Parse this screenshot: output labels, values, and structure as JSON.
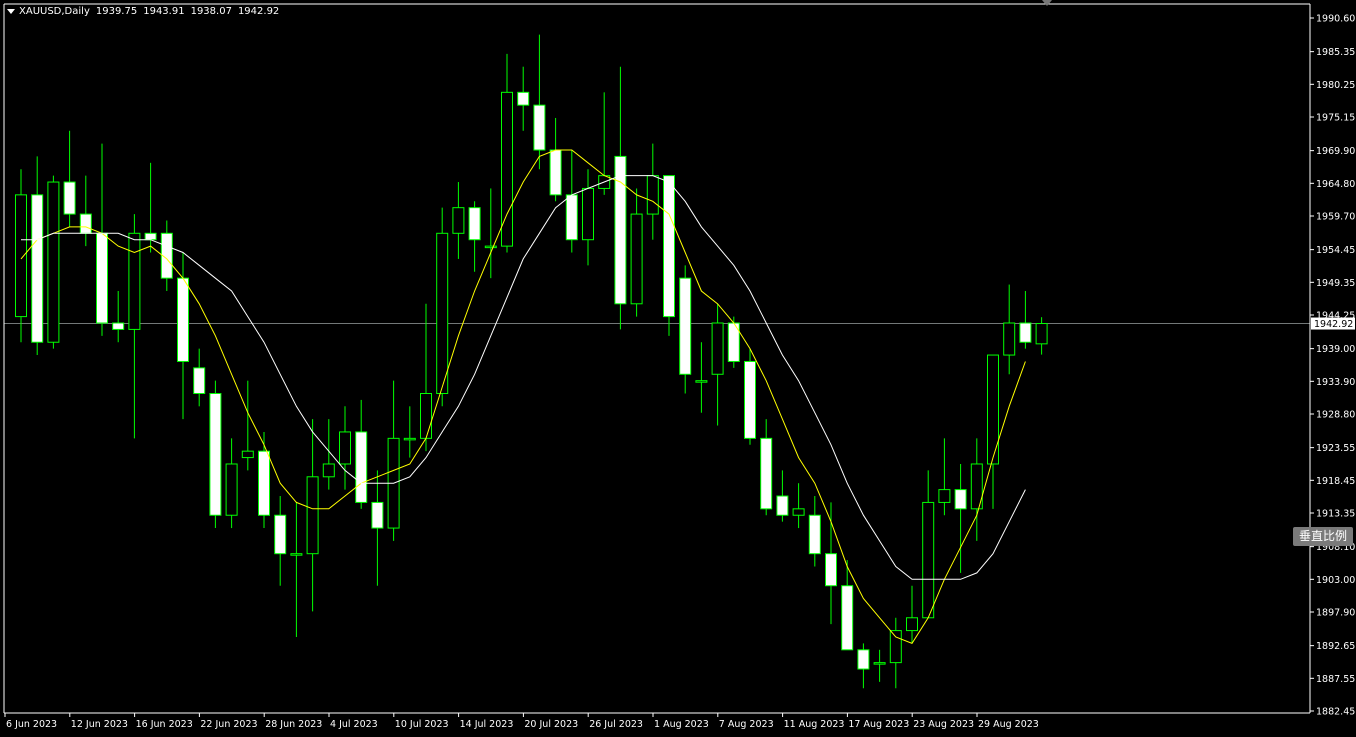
{
  "header": {
    "symbol": "XAUUSD,Daily",
    "open": "1939.75",
    "high": "1943.91",
    "low": "1938.07",
    "close": "1942.92"
  },
  "scale_button_label": "垂直比例",
  "colors": {
    "background": "#000000",
    "up_candle": "#000000",
    "down_candle": "#ffffff",
    "wick": "#00ff00",
    "ma_fast": "#ffff00",
    "ma_slow": "#ffffff",
    "axis": "#ffffff"
  },
  "chart_data": {
    "type": "candlestick",
    "title": "",
    "xlabel": "",
    "ylabel": "",
    "current_price": 1942.92,
    "ylim": [
      1882.45,
      1992.0
    ],
    "y_ticks": [
      "1990.60",
      "1985.35",
      "1980.25",
      "1975.15",
      "1969.90",
      "1964.80",
      "1959.70",
      "1954.45",
      "1949.35",
      "1944.25",
      "1939.00",
      "1933.90",
      "1928.80",
      "1923.55",
      "1918.45",
      "1913.35",
      "1908.10",
      "1903.00",
      "1897.90",
      "1892.65",
      "1887.55",
      "1882.45"
    ],
    "x_ticks": [
      {
        "label": "6 Jun 2023",
        "index": 0
      },
      {
        "label": "12 Jun 2023",
        "index": 4
      },
      {
        "label": "16 Jun 2023",
        "index": 8
      },
      {
        "label": "22 Jun 2023",
        "index": 12
      },
      {
        "label": "28 Jun 2023",
        "index": 16
      },
      {
        "label": "4 Jul 2023",
        "index": 20
      },
      {
        "label": "10 Jul 2023",
        "index": 24
      },
      {
        "label": "14 Jul 2023",
        "index": 28
      },
      {
        "label": "20 Jul 2023",
        "index": 32
      },
      {
        "label": "26 Jul 2023",
        "index": 36
      },
      {
        "label": "1 Aug 2023",
        "index": 40
      },
      {
        "label": "7 Aug 2023",
        "index": 44
      },
      {
        "label": "11 Aug 2023",
        "index": 48
      },
      {
        "label": "17 Aug 2023",
        "index": 52
      },
      {
        "label": "23 Aug 2023",
        "index": 56
      },
      {
        "label": "29 Aug 2023",
        "index": 60
      }
    ],
    "candles": [
      {
        "o": 1944,
        "h": 1967,
        "l": 1940,
        "c": 1963
      },
      {
        "o": 1963,
        "h": 1969,
        "l": 1938,
        "c": 1940
      },
      {
        "o": 1940,
        "h": 1966,
        "l": 1939,
        "c": 1965
      },
      {
        "o": 1965,
        "h": 1973,
        "l": 1958,
        "c": 1960
      },
      {
        "o": 1960,
        "h": 1966,
        "l": 1955,
        "c": 1957
      },
      {
        "o": 1957,
        "h": 1971,
        "l": 1941,
        "c": 1943
      },
      {
        "o": 1943,
        "h": 1948,
        "l": 1940,
        "c": 1942
      },
      {
        "o": 1942,
        "h": 1960,
        "l": 1925,
        "c": 1957
      },
      {
        "o": 1957,
        "h": 1968,
        "l": 1954,
        "c": 1956
      },
      {
        "o": 1957,
        "h": 1959,
        "l": 1948,
        "c": 1950
      },
      {
        "o": 1950,
        "h": 1954,
        "l": 1928,
        "c": 1937
      },
      {
        "o": 1936,
        "h": 1939,
        "l": 1930,
        "c": 1932
      },
      {
        "o": 1932,
        "h": 1934,
        "l": 1911,
        "c": 1913
      },
      {
        "o": 1913,
        "h": 1925,
        "l": 1911,
        "c": 1921
      },
      {
        "o": 1922,
        "h": 1934,
        "l": 1920,
        "c": 1923
      },
      {
        "o": 1923,
        "h": 1926,
        "l": 1911,
        "c": 1913
      },
      {
        "o": 1913,
        "h": 1916,
        "l": 1902,
        "c": 1907
      },
      {
        "o": 1907,
        "h": 1915,
        "l": 1894,
        "c": 1907
      },
      {
        "o": 1907,
        "h": 1928,
        "l": 1898,
        "c": 1919
      },
      {
        "o": 1919,
        "h": 1928,
        "l": 1917,
        "c": 1921
      },
      {
        "o": 1921,
        "h": 1930,
        "l": 1917,
        "c": 1926
      },
      {
        "o": 1926,
        "h": 1931,
        "l": 1914,
        "c": 1915
      },
      {
        "o": 1915,
        "h": 1920,
        "l": 1902,
        "c": 1911
      },
      {
        "o": 1911,
        "h": 1934,
        "l": 1909,
        "c": 1925
      },
      {
        "o": 1925,
        "h": 1930,
        "l": 1922,
        "c": 1925
      },
      {
        "o": 1925,
        "h": 1946,
        "l": 1923,
        "c": 1932
      },
      {
        "o": 1932,
        "h": 1961,
        "l": 1930,
        "c": 1957
      },
      {
        "o": 1957,
        "h": 1965,
        "l": 1953,
        "c": 1961
      },
      {
        "o": 1961,
        "h": 1962,
        "l": 1951,
        "c": 1956
      },
      {
        "o": 1955,
        "h": 1964,
        "l": 1950,
        "c": 1955
      },
      {
        "o": 1955,
        "h": 1985,
        "l": 1954,
        "c": 1979
      },
      {
        "o": 1979,
        "h": 1983,
        "l": 1973,
        "c": 1977
      },
      {
        "o": 1977,
        "h": 1988,
        "l": 1967,
        "c": 1970
      },
      {
        "o": 1970,
        "h": 1975,
        "l": 1962,
        "c": 1963
      },
      {
        "o": 1963,
        "h": 1970,
        "l": 1954,
        "c": 1956
      },
      {
        "o": 1956,
        "h": 1967,
        "l": 1952,
        "c": 1964
      },
      {
        "o": 1964,
        "h": 1979,
        "l": 1963,
        "c": 1966
      },
      {
        "o": 1969,
        "h": 1983,
        "l": 1942,
        "c": 1946
      },
      {
        "o": 1946,
        "h": 1964,
        "l": 1944,
        "c": 1960
      },
      {
        "o": 1960,
        "h": 1971,
        "l": 1956,
        "c": 1966
      },
      {
        "o": 1966,
        "h": 1966,
        "l": 1941,
        "c": 1944
      },
      {
        "o": 1950,
        "h": 1952,
        "l": 1932,
        "c": 1935
      },
      {
        "o": 1934,
        "h": 1940,
        "l": 1929,
        "c": 1934
      },
      {
        "o": 1935,
        "h": 1946,
        "l": 1927,
        "c": 1943
      },
      {
        "o": 1943,
        "h": 1944,
        "l": 1936,
        "c": 1937
      },
      {
        "o": 1937,
        "h": 1939,
        "l": 1924,
        "c": 1925
      },
      {
        "o": 1925,
        "h": 1928,
        "l": 1913,
        "c": 1914
      },
      {
        "o": 1916,
        "h": 1920,
        "l": 1912,
        "c": 1913
      },
      {
        "o": 1913,
        "h": 1918,
        "l": 1911,
        "c": 1914
      },
      {
        "o": 1913,
        "h": 1916,
        "l": 1905,
        "c": 1907
      },
      {
        "o": 1907,
        "h": 1915,
        "l": 1896,
        "c": 1902
      },
      {
        "o": 1902,
        "h": 1906,
        "l": 1892,
        "c": 1892
      },
      {
        "o": 1892,
        "h": 1893,
        "l": 1886,
        "c": 1889
      },
      {
        "o": 1890,
        "h": 1892,
        "l": 1887,
        "c": 1890
      },
      {
        "o": 1890,
        "h": 1897,
        "l": 1886,
        "c": 1895
      },
      {
        "o": 1895,
        "h": 1902,
        "l": 1893,
        "c": 1897
      },
      {
        "o": 1897,
        "h": 1920,
        "l": 1897,
        "c": 1915
      },
      {
        "o": 1915,
        "h": 1925,
        "l": 1913,
        "c": 1917
      },
      {
        "o": 1917,
        "h": 1921,
        "l": 1904,
        "c": 1914
      },
      {
        "o": 1914,
        "h": 1925,
        "l": 1909,
        "c": 1921
      },
      {
        "o": 1921,
        "h": 1938,
        "l": 1914,
        "c": 1938
      },
      {
        "o": 1938,
        "h": 1949,
        "l": 1935,
        "c": 1943
      },
      {
        "o": 1943,
        "h": 1948,
        "l": 1939,
        "c": 1940
      },
      {
        "o": 1939.75,
        "h": 1943.91,
        "l": 1938.07,
        "c": 1942.92
      }
    ],
    "series": [
      {
        "type": "line",
        "values": [
          1953,
          1956,
          1957,
          1958,
          1958,
          1957,
          1955,
          1954,
          1955,
          1953,
          1950,
          1946,
          1941,
          1935,
          1929,
          1924,
          1918,
          1915,
          1914,
          1914,
          1916,
          1918,
          1919,
          1920,
          1921,
          1925,
          1933,
          1941,
          1948,
          1954,
          1960,
          1965,
          1969,
          1970,
          1970,
          1968,
          1966,
          1965,
          1963,
          1962,
          1960,
          1954,
          1948,
          1946,
          1943,
          1939,
          1934,
          1928,
          1922,
          1918,
          1912,
          1905,
          1900,
          1897,
          1894,
          1893,
          1897,
          1903,
          1908,
          1913,
          1922,
          1930,
          1937
        ]
      },
      {
        "type": "line",
        "values": [
          1956,
          1956,
          1957,
          1957,
          1957,
          1957,
          1957,
          1956,
          1956,
          1955,
          1954,
          1952,
          1950,
          1948,
          1944,
          1940,
          1935,
          1930,
          1926,
          1923,
          1920,
          1918,
          1918,
          1918,
          1919,
          1922,
          1926,
          1930,
          1935,
          1941,
          1947,
          1953,
          1957,
          1961,
          1963,
          1964,
          1965,
          1966,
          1966,
          1966,
          1965,
          1962,
          1958,
          1955,
          1952,
          1948,
          1943,
          1938,
          1934,
          1929,
          1924,
          1918,
          1913,
          1909,
          1905,
          1903,
          1903,
          1903,
          1903,
          1904,
          1907,
          1912,
          1917
        ]
      }
    ]
  }
}
